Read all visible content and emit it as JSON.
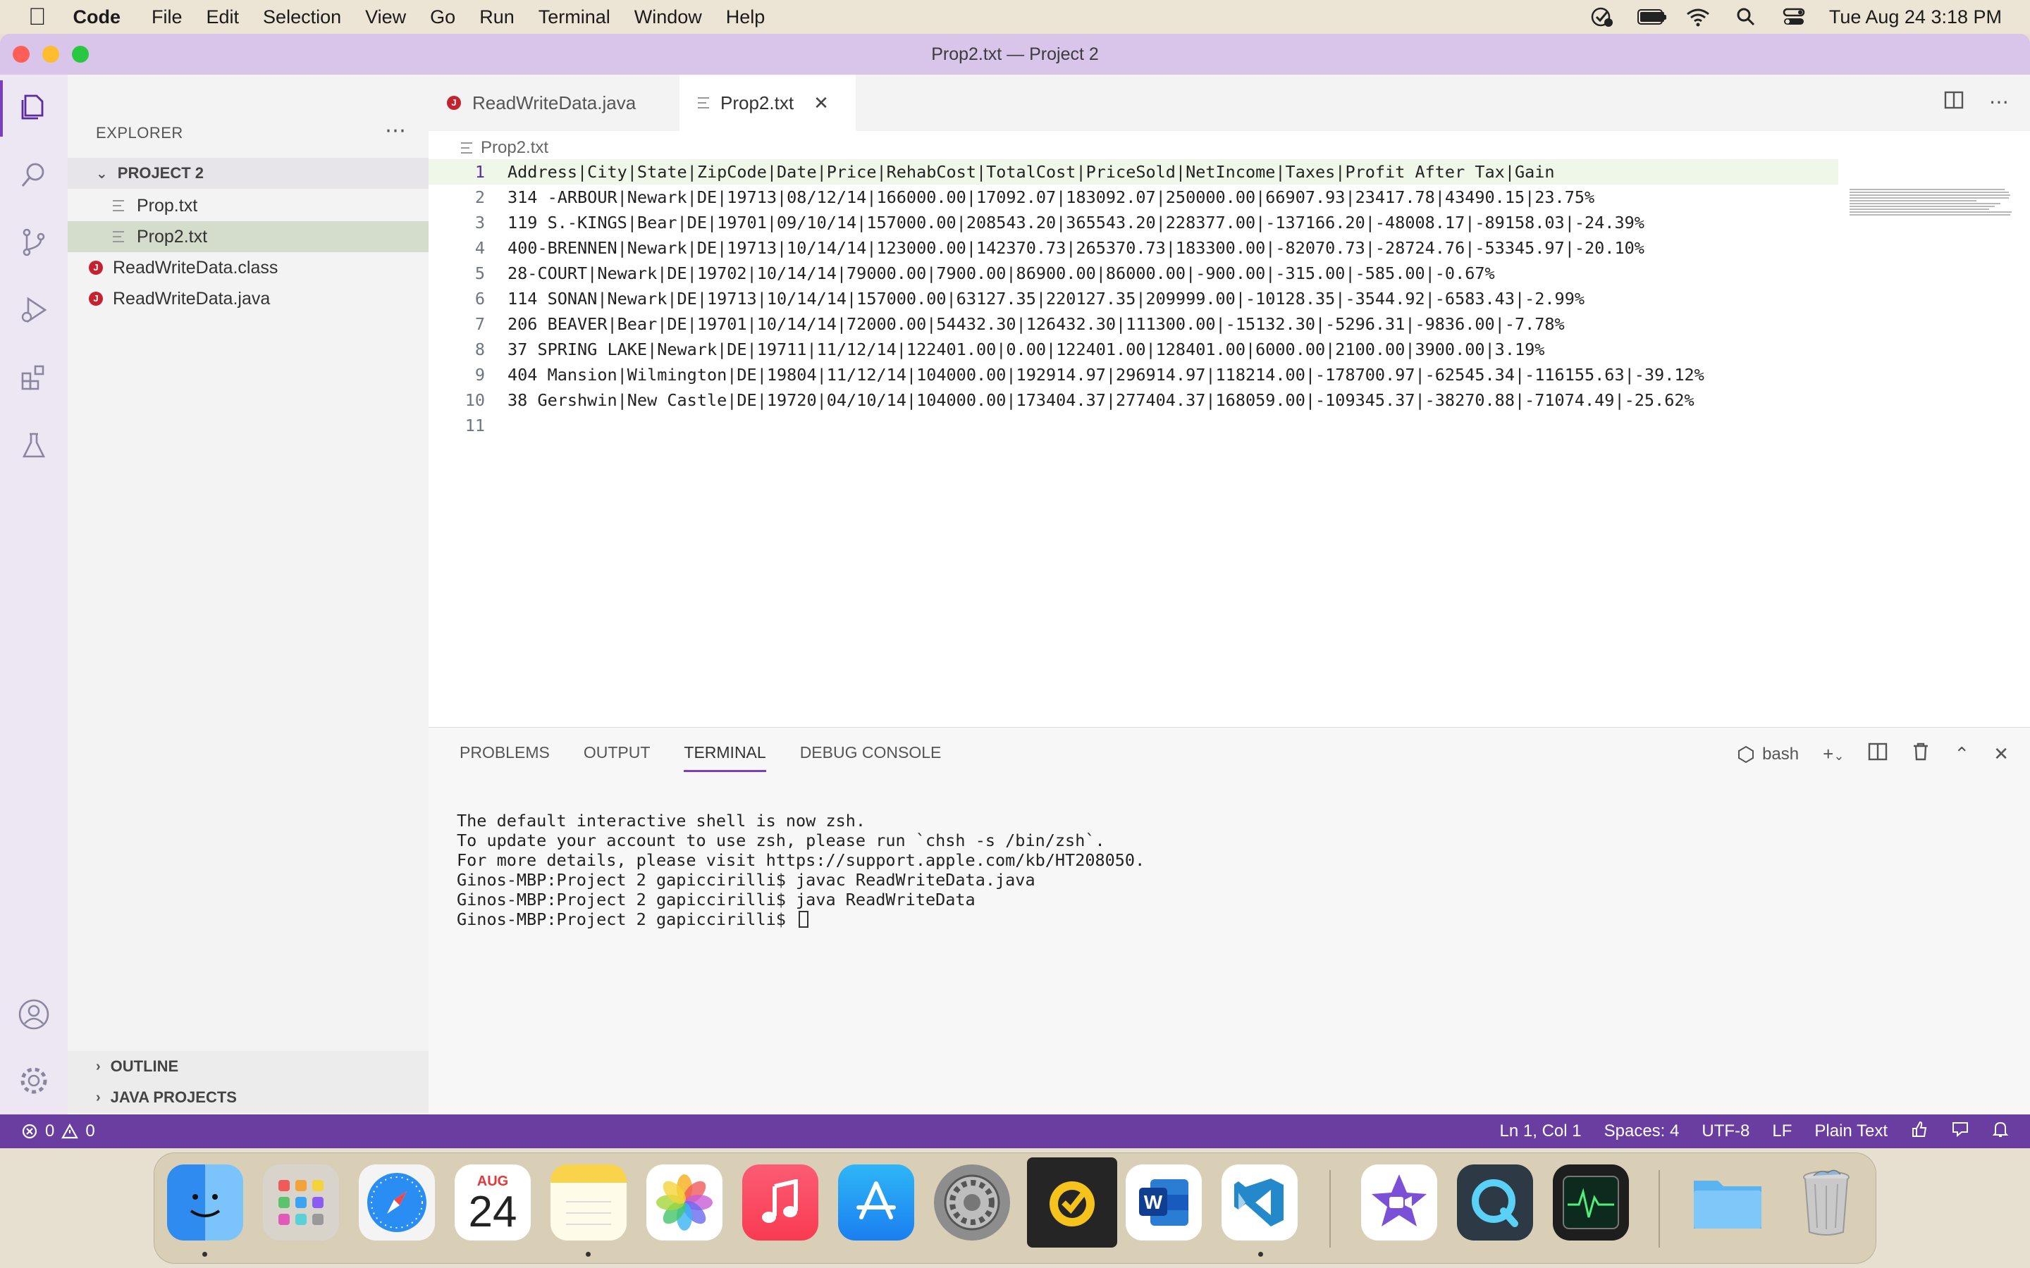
{
  "menubar": {
    "app_name": "Code",
    "items": [
      "File",
      "Edit",
      "Selection",
      "View",
      "Go",
      "Run",
      "Terminal",
      "Window",
      "Help"
    ],
    "clock": "Tue Aug 24  3:18 PM"
  },
  "window": {
    "title": "Prop2.txt — Project 2"
  },
  "sidebar": {
    "header": "EXPLORER",
    "project": "PROJECT 2",
    "files": [
      {
        "name": "Prop.txt",
        "type": "txt"
      },
      {
        "name": "Prop2.txt",
        "type": "txt"
      },
      {
        "name": "ReadWriteData.class",
        "type": "java"
      },
      {
        "name": "ReadWriteData.java",
        "type": "java"
      }
    ],
    "outline": "OUTLINE",
    "java_projects": "JAVA PROJECTS"
  },
  "tabs": [
    {
      "label": "ReadWriteData.java"
    },
    {
      "label": "Prop2.txt"
    }
  ],
  "editor": {
    "breadcrumb": "Prop2.txt",
    "lines": [
      "Address|City|State|ZipCode|Date|Price|RehabCost|TotalCost|PriceSold|NetIncome|Taxes|Profit After Tax|Gain",
      "314 -ARBOUR|Newark|DE|19713|08/12/14|166000.00|17092.07|183092.07|250000.00|66907.93|23417.78|43490.15|23.75%",
      "119 S.-KINGS|Bear|DE|19701|09/10/14|157000.00|208543.20|365543.20|228377.00|-137166.20|-48008.17|-89158.03|-24.39%",
      "400-BRENNEN|Newark|DE|19713|10/14/14|123000.00|142370.73|265370.73|183300.00|-82070.73|-28724.76|-53345.97|-20.10%",
      "28-COURT|Newark|DE|19702|10/14/14|79000.00|7900.00|86900.00|86000.00|-900.00|-315.00|-585.00|-0.67%",
      "114 SONAN|Newark|DE|19713|10/14/14|157000.00|63127.35|220127.35|209999.00|-10128.35|-3544.92|-6583.43|-2.99%",
      "206 BEAVER|Bear|DE|19701|10/14/14|72000.00|54432.30|126432.30|111300.00|-15132.30|-5296.31|-9836.00|-7.78%",
      "37 SPRING LAKE|Newark|DE|19711|11/12/14|122401.00|0.00|122401.00|128401.00|6000.00|2100.00|3900.00|3.19%",
      "404 Mansion|Wilmington|DE|19804|11/12/14|104000.00|192914.97|296914.97|118214.00|-178700.97|-62545.34|-116155.63|-39.12%",
      "38 Gershwin|New Castle|DE|19720|04/10/14|104000.00|173404.37|277404.37|168059.00|-109345.37|-38270.88|-71074.49|-25.62%",
      ""
    ],
    "line_numbers": [
      "1",
      "2",
      "3",
      "4",
      "5",
      "6",
      "7",
      "8",
      "9",
      "10",
      "11"
    ]
  },
  "panel": {
    "tabs": [
      "PROBLEMS",
      "OUTPUT",
      "TERMINAL",
      "DEBUG CONSOLE"
    ],
    "shell": "bash",
    "terminal_lines": [
      "The default interactive shell is now zsh.",
      "To update your account to use zsh, please run `chsh -s /bin/zsh`.",
      "For more details, please visit https://support.apple.com/kb/HT208050.",
      "Ginos-MBP:Project 2 gapiccirilli$ javac ReadWriteData.java",
      "Ginos-MBP:Project 2 gapiccirilli$ java ReadWriteData",
      "Ginos-MBP:Project 2 gapiccirilli$ "
    ]
  },
  "statusbar": {
    "errors": "0",
    "warnings": "0",
    "position": "Ln 1, Col 1",
    "spaces": "Spaces: 4",
    "encoding": "UTF-8",
    "eol": "LF",
    "language": "Plain Text"
  },
  "dock": {
    "calendar_month": "AUG",
    "calendar_day": "24",
    "word_letter": "W"
  },
  "colors": {
    "titlebar": "#d9c4ea",
    "statusbar": "#6a3ea0",
    "accent": "#7b3fbe"
  }
}
